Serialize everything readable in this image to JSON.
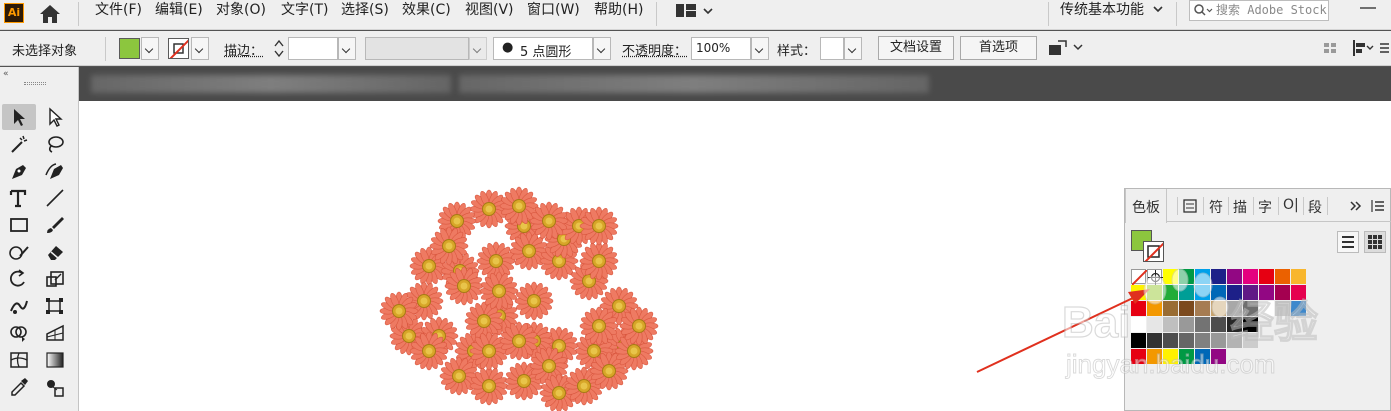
{
  "app": {
    "logo": "Ai",
    "accent": "#ff9a00"
  },
  "menu": {
    "items": [
      "文件(F)",
      "编辑(E)",
      "对象(O)",
      "文字(T)",
      "选择(S)",
      "效果(C)",
      "视图(V)",
      "窗口(W)",
      "帮助(H)"
    ],
    "workspace": "传统基本功能",
    "search_placeholder": "搜索 Adobe Stock"
  },
  "control": {
    "selection_status": "未选择对象",
    "fill_color": "#8cc63e",
    "stroke_label": "描边：",
    "brush_value": "5 点圆形",
    "opacity_label": "不透明度：",
    "opacity_value": "100%",
    "style_label": "样式：",
    "doc_setup_button": "文档设置",
    "preferences_button": "首选项"
  },
  "swatches_panel": {
    "tabs": [
      "色板",
      "画",
      "符",
      "描",
      "字",
      "O|",
      "段"
    ],
    "active_tab": "色板",
    "fill_color": "#8cc63e",
    "row1": [
      "#ffffff",
      "#000000",
      "#ffff00",
      "#009944",
      "#00a0e9",
      "#1d2088",
      "#920783",
      "#e4007f",
      "#e60012",
      "#eb6100",
      "#f8b62d"
    ],
    "row2": [
      "#fff100",
      "#8fc31f",
      "#22ac38",
      "#009e96",
      "#00a0e9",
      "#0068b7",
      "#1d2088",
      "#601986",
      "#920783",
      "#a40050",
      "#e5004f"
    ],
    "row3": [
      "#e60012",
      "#f39800",
      "#996c33",
      "#7c4a1e",
      "#a67c52",
      "#c7a46e",
      "#a8a8a8",
      "#6f6f6f",
      "#ffffff",
      "#c9c9c9",
      "#3e88cc"
    ],
    "row4": [
      "#ffffff",
      "#e6e6e6",
      "#bfbfbf",
      "#999999",
      "#737373",
      "#4d4d4d",
      "#262626",
      "#000000"
    ],
    "row5": [
      "#000000",
      "#333333",
      "#4d4d4d",
      "#666666",
      "#808080",
      "#999999",
      "#b3b3b3",
      "#cccccc"
    ],
    "row6": [
      "#e60012",
      "#f39800",
      "#fff100",
      "#009944",
      "#0068b7",
      "#920783"
    ]
  },
  "flowers": {
    "petal_color": "#ee7a62",
    "center_color": "#d7a628"
  },
  "annotation": {
    "arrow_color": "#e0301e"
  },
  "watermark": {
    "brand": "Baidu 经验",
    "url": "jingyan.baidu.com"
  }
}
